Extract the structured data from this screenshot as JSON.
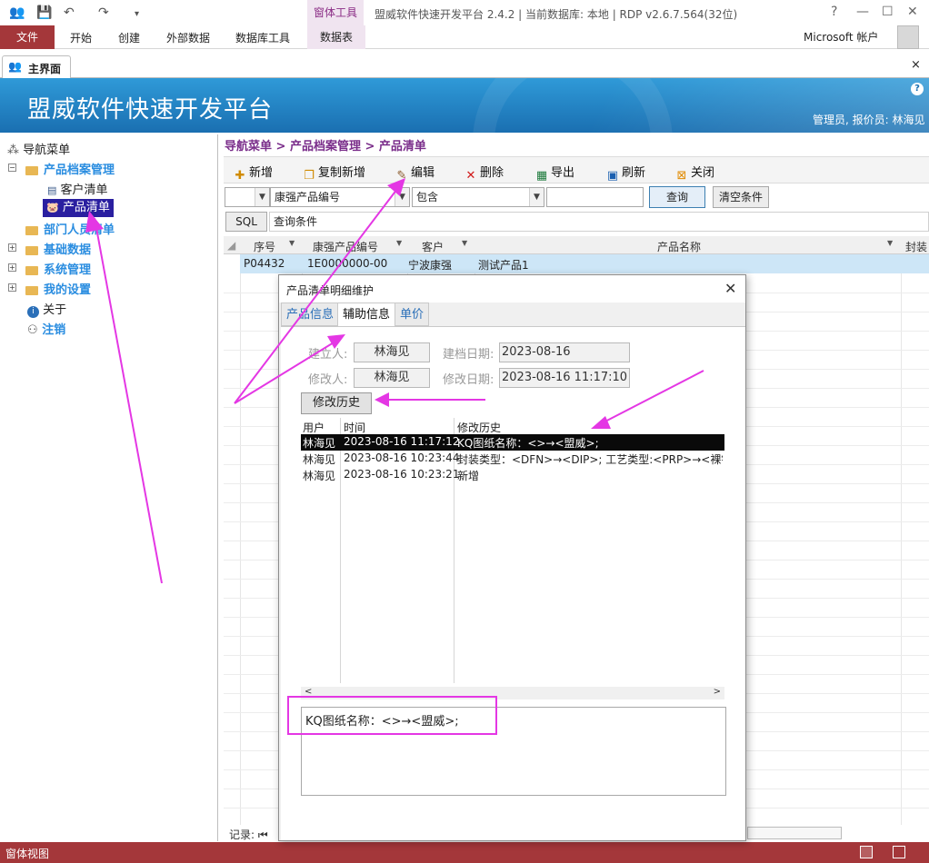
{
  "titlebar": {
    "context_tools_label": "窗体工具",
    "window_title": "盟威软件快速开发平台 2.4.2 | 当前数据库: 本地 | RDP v2.6.7.564(32位)",
    "help": "?",
    "min": "—",
    "max": "☐",
    "close": "✕"
  },
  "ribbon": {
    "file": "文件",
    "tabs": [
      "开始",
      "创建",
      "外部数据",
      "数据库工具"
    ],
    "context_tab": "数据表",
    "account": "Microsoft 帐户"
  },
  "doc_tab": {
    "label": "主界面",
    "close": "×"
  },
  "banner": {
    "title": "盟威软件快速开发平台",
    "help": "?",
    "user": "管理员, 报价员: 林海见"
  },
  "nav": {
    "root": "导航菜单",
    "items": [
      {
        "label": "产品档案管理"
      },
      {
        "label": "客户清单"
      },
      {
        "label": "产品清单"
      },
      {
        "label": "部门人员清单"
      },
      {
        "label": "基础数据"
      },
      {
        "label": "系统管理"
      },
      {
        "label": "我的设置"
      },
      {
        "label": "关于"
      },
      {
        "label": "注销"
      }
    ]
  },
  "breadcrumb": "导航菜单 > 产品档案管理 > 产品清单",
  "toolbar": {
    "add": "新增",
    "copy_add": "复制新增",
    "edit": "编辑",
    "delete": "删除",
    "export": "导出",
    "refresh": "刷新",
    "close": "关闭"
  },
  "filter": {
    "field": "康强产品编号",
    "op": "包含",
    "query": "查询",
    "clear": "清空条件",
    "sql": "SQL",
    "cond_label": "查询条件"
  },
  "grid": {
    "headers": [
      "序号",
      "康强产品编号",
      "客户",
      "产品名称",
      "封装"
    ],
    "row": [
      "P04432",
      "1E0000000-00",
      "宁波康强",
      "测试产品1"
    ]
  },
  "record_label": "记录:",
  "status": {
    "text": "窗体视图"
  },
  "dialog": {
    "title": "产品清单明细维护",
    "close": "✕",
    "tabs": [
      "产品信息",
      "辅助信息",
      "单价"
    ],
    "fields": {
      "creator_label": "建立人:",
      "creator": "林海见",
      "create_date_label": "建档日期:",
      "create_date": "2023-08-16",
      "modifier_label": "修改人:",
      "modifier": "林海见",
      "modify_date_label": "修改日期:",
      "modify_date": "2023-08-16 11:17:10"
    },
    "history_button": "修改历史",
    "list_headers": [
      "用户",
      "时间",
      "修改历史"
    ],
    "rows": [
      {
        "user": "林海见",
        "time": "2023-08-16 11:17:12",
        "change": "KQ图纸名称：<>→<盟威>;"
      },
      {
        "user": "林海见",
        "time": "2023-08-16 10:23:44",
        "change": "封装类型：<DFN>→<DIP>; 工艺类型:<PRP>→<裸铜"
      },
      {
        "user": "林海见",
        "time": "2023-08-16 10:23:21",
        "change": "新增"
      }
    ],
    "memo": "KQ图纸名称：<>→<盟威>;"
  },
  "colors": {
    "accent": "#a4373a",
    "banner": "#1a6fb1",
    "annotation": "#e437e4"
  }
}
